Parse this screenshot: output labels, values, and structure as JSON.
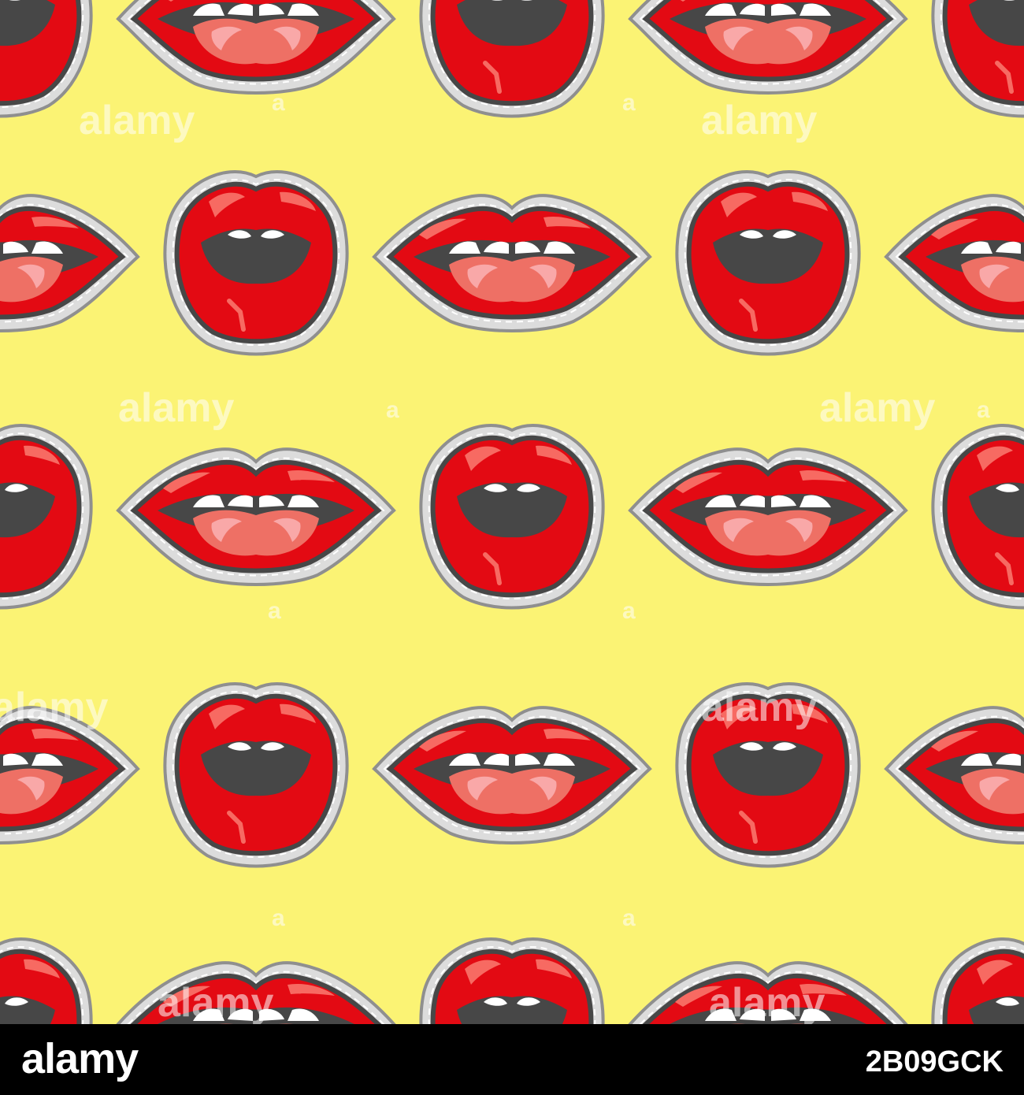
{
  "colors": {
    "background": "#fbf374",
    "lip_red": "#e30a13",
    "lip_outline": "#474747",
    "stitch_border": "#8f8f8f",
    "highlight": "#f76a62",
    "tongue": "#ee7065",
    "tongue_highlight": "#f9a8a8",
    "teeth": "#ffffff",
    "mouth": "#474747",
    "footer": "#000000",
    "footer_text": "#ffffff"
  },
  "pattern": {
    "motifs": [
      "wide-lips-sticker",
      "round-lips-sticker"
    ],
    "watermark_text": "alamy"
  },
  "footer": {
    "brand": "alamy",
    "image_id": "2B09GCK"
  }
}
